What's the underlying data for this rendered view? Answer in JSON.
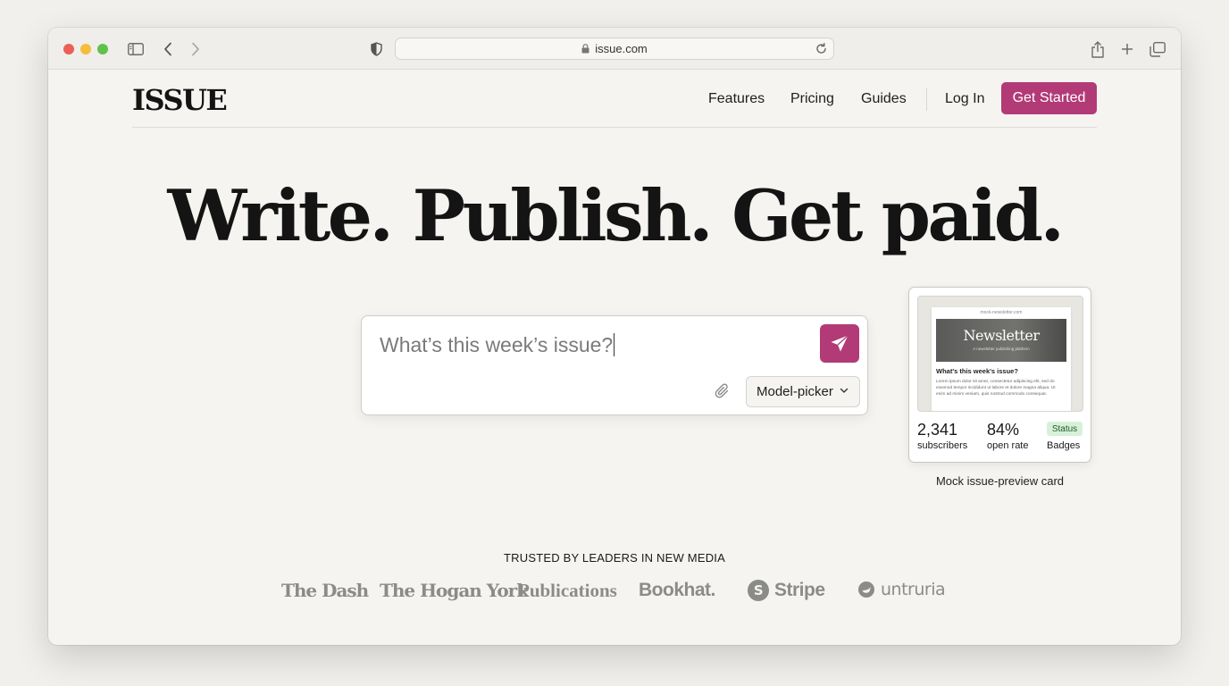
{
  "browser": {
    "url": "issue.com"
  },
  "site": {
    "logo": "ISSUE",
    "nav": {
      "features": "Features",
      "pricing": "Pricing",
      "guides": "Guides",
      "login": "Log In",
      "cta": "Get Started"
    }
  },
  "hero": {
    "headline": "Write. Publish. Get paid."
  },
  "composer": {
    "placeholder": "What’s this week’s issue?",
    "model_picker": "Model-picker"
  },
  "preview_card": {
    "url": "mock-newsletter.com",
    "banner_title": "Newsletter",
    "banner_subtitle": "A newsletter publishing platform",
    "heading": "What's this week's issue?",
    "body": "Lorem ipsum dolor sit amet, consectetur adipiscing elit, sed do eiusmod tempor incididunt ut labore et dolore magna aliqua. Ut enim ad minim veniam, quis nostrud commodo consequat.",
    "stats": [
      {
        "value": "2,341",
        "label": "subscribers"
      },
      {
        "value": "84%",
        "label": "open rate"
      }
    ],
    "badge": "Status",
    "badge_label": "Badges",
    "caption": "Mock issue-preview card"
  },
  "logos": {
    "heading": "TRUSTED BY LEADERS IN NEW MEDIA",
    "items": [
      "The Dash",
      "The Hogan York",
      "Publications",
      "Bookhat.",
      "Stripe",
      "untruria"
    ]
  },
  "colors": {
    "accent": "#b23a76",
    "background": "#f5f4f0",
    "badge_green": "#d7f1d9"
  }
}
